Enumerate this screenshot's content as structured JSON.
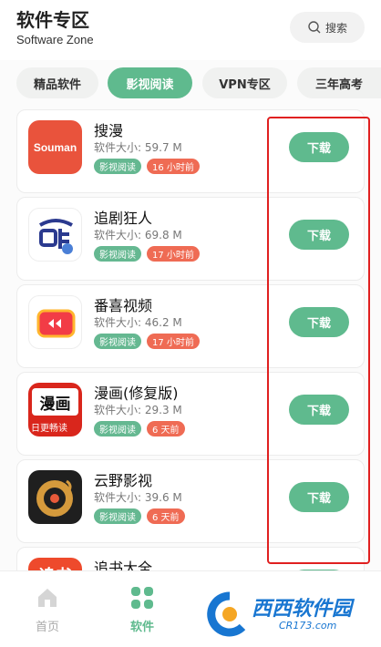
{
  "header": {
    "title": "软件专区",
    "subtitle": "Software Zone",
    "search_label": "搜索"
  },
  "tabs": [
    {
      "label": "精品软件",
      "active": false
    },
    {
      "label": "影视阅读",
      "active": true
    },
    {
      "label": "VPN专区",
      "active": false
    },
    {
      "label": "三年高考",
      "active": false
    }
  ],
  "apps": [
    {
      "name": "搜漫",
      "size": "软件大小:  59.7 M",
      "category": "影视阅读",
      "time": "16 小时前",
      "button": "下载",
      "icon_text": "Souman"
    },
    {
      "name": "追剧狂人",
      "size": "软件大小:  69.8 M",
      "category": "影视阅读",
      "time": "17 小时前",
      "button": "下载"
    },
    {
      "name": "番喜视频",
      "size": "软件大小:  46.2 M",
      "category": "影视阅读",
      "time": "17 小时前",
      "button": "下载"
    },
    {
      "name": "漫画(修复版)",
      "size": "软件大小:  29.3 M",
      "category": "影视阅读",
      "time": "6 天前",
      "button": "下载",
      "icon_text": "漫画",
      "icon_sub": "日更畅读"
    },
    {
      "name": "云野影视",
      "size": "软件大小:  39.6 M",
      "category": "影视阅读",
      "time": "6 天前",
      "button": "下载"
    },
    {
      "name": "追书大全",
      "icon_text": "追书"
    }
  ],
  "bottom_nav": [
    {
      "label": "首页",
      "active": false
    },
    {
      "label": "软件",
      "active": true
    }
  ],
  "watermark": {
    "text": "西西软件园",
    "url": "CR173.com"
  },
  "colors": {
    "accent": "#5fba8e",
    "time_badge": "#ef6b54",
    "highlight": "#e02020"
  }
}
